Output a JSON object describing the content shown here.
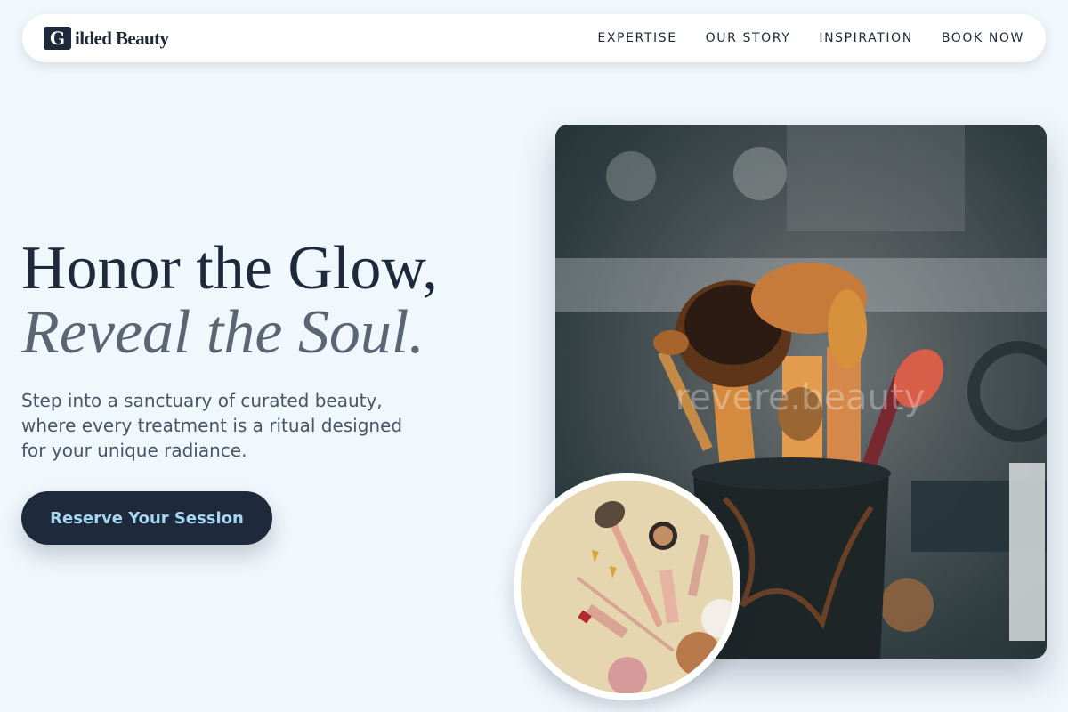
{
  "brand": {
    "mark": "G",
    "name": "ilded Beauty"
  },
  "nav": {
    "links": [
      {
        "label": "EXPERTISE"
      },
      {
        "label": "OUR STORY"
      },
      {
        "label": "INSPIRATION"
      },
      {
        "label": "BOOK NOW"
      }
    ]
  },
  "hero": {
    "title_line1": "Honor the Glow,",
    "title_line2": "Reveal the Soul.",
    "subtitle": "Step into a sanctuary of curated beauty, where every treatment is a ritual designed for your unique radiance.",
    "cta_label": "Reserve Your Session"
  },
  "images": {
    "main_watermark": "revere.beauty"
  },
  "colors": {
    "background": "#f0f7fd",
    "primary": "#1e293b",
    "cta_text": "#a6d8f2",
    "muted": "#5b6573"
  }
}
